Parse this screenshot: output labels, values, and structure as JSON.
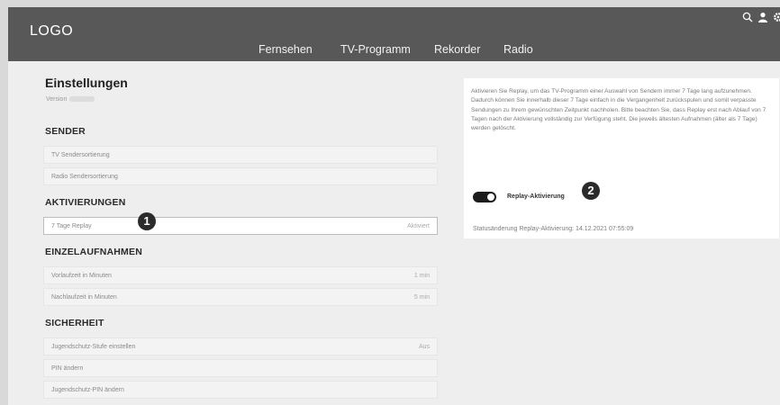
{
  "header": {
    "logo": "LOGO",
    "nav": [
      "Fernsehen",
      "TV-Programm",
      "Rekorder",
      "Radio"
    ],
    "icons": [
      "search-icon",
      "user-icon",
      "gear-icon"
    ],
    "bg_color": "#585858"
  },
  "settings": {
    "title": "Einstellungen",
    "version_label": "Version",
    "sections": [
      {
        "title": "SENDER",
        "rows": [
          {
            "label": "TV Sendersortierung",
            "value": ""
          },
          {
            "label": "Radio Sendersortierung",
            "value": ""
          }
        ]
      },
      {
        "title": "AKTIVIERUNGEN",
        "rows": [
          {
            "label": "7 Tage Replay",
            "value": "Aktiviert"
          }
        ]
      },
      {
        "title": "EINZELAUFNAHMEN",
        "rows": [
          {
            "label": "Vorlaufzeit in Minuten",
            "value": "1 min"
          },
          {
            "label": "Nachlaufzeit in Minuten",
            "value": "5 min"
          }
        ]
      },
      {
        "title": "SICHERHEIT",
        "rows": [
          {
            "label": "Jugendschutz-Stufe einstellen",
            "value": "Aus"
          },
          {
            "label": "PIN ändern",
            "value": ""
          },
          {
            "label": "Jugendschutz-PIN ändern",
            "value": ""
          }
        ]
      }
    ]
  },
  "badges": {
    "one": "1",
    "two": "2"
  },
  "replay": {
    "description": "Aktivieren Sie Replay, um das TV-Programm einer Auswahl von Sendern immer 7 Tage lang aufzunehmen. Dadurch können Sie innerhalb dieser 7 Tage einfach in die Vergangenheit zurückspulen und somit verpasste Sendungen zu Ihrem gewünschten Zeitpunkt nachholen. Bitte beachten Sie, dass Replay erst nach Ablauf von 7 Tagen nach der Aktivierung vollständig zur Verfügung steht. Die jeweils ältesten Aufnahmen (älter als 7 Tage) werden gelöscht.",
    "toggle_label": "Replay-Aktivierung",
    "toggle_on": true,
    "status": "Statusänderung Replay-Aktivierung: 14.12.2021 07:55:09"
  }
}
